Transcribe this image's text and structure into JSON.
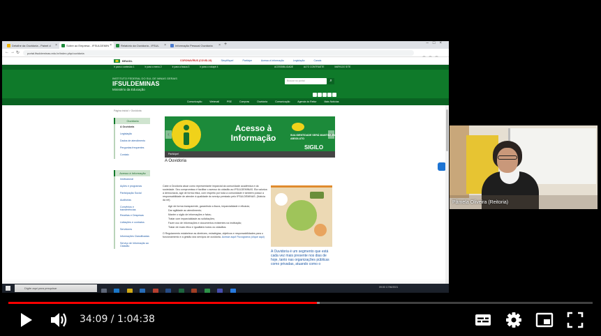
{
  "browser": {
    "tabs": [
      {
        "label": "Detalhe da Ouvidoria - Painel d",
        "active": false,
        "color": "#f0b400"
      },
      {
        "label": "Sobre ao Empresa - IFSULDEMIN",
        "active": true,
        "color": "#1d8a3b"
      },
      {
        "label": "Relatório da Ouvidoria - IFSUL",
        "active": false,
        "color": "#1d8a3b"
      },
      {
        "label": "Informação Pessoal Ouvidoria",
        "active": false,
        "color": "#4a7bd0"
      }
    ],
    "url": "portal.ifsuldeminas.edu.br/index.php/ouvidoria"
  },
  "gov_bar": {
    "brand": "BRASIL",
    "links": [
      "CORONAVÍRUS (COVID-19)",
      "Simplifique!",
      "Participe",
      "Acesso à Informação",
      "Legislação",
      "Canais"
    ]
  },
  "header": {
    "accessibility_links": [
      "Ir para o conteúdo 1",
      "Ir para o menu 2",
      "Ir para a busca 3",
      "Ir para o rodapé 4"
    ],
    "accessibility_right": [
      "ACESSIBILIDADE",
      "ALTO CONTRASTE",
      "MAPA DO SITE"
    ],
    "institution_small": "INSTITUTO FEDERAL DO SUL DE MINAS GERAIS",
    "institution_name": "IFSULDEMINAS",
    "ministry": "Ministério da Educação",
    "search_placeholder": "Buscar no portal",
    "menu": [
      "Comunicação",
      "Webmail",
      "PSE",
      "Compras",
      "Ouvidoria",
      "Comunicação",
      "Agenda do Reitor",
      "Mais Notícias"
    ]
  },
  "page": {
    "breadcrumb": "Página inicial > Ouvidoria",
    "sidebar_heading_1": "Ouvidoria",
    "sidebar_items_1": [
      "A Ouvidoria",
      "Legislação",
      "Dados de atendimento",
      "Perguntas frequentes",
      "Contato"
    ],
    "sidebar_heading_2": "Acesso à Informação",
    "sidebar_items_2": [
      "Institucional",
      "Ações e programas",
      "Participação Social",
      "Auditorias",
      "Convênios e transferências",
      "Receitas e Despesas",
      "Licitações e contratos",
      "Servidores",
      "Informações Classificadas",
      "Serviço de Informação ao Cidadão"
    ],
    "banner_title": "Acesso à Informação",
    "banner_tag": "SUA IDENTIDADE SERÁ MANTIDA EM ABSOLUTO",
    "banner_sigilo": "SIGILO",
    "banner_caption": "Participe!",
    "heading": "A Ouvidoria",
    "paragraph_1": "Cabe à Ouvidoria atuar como representante imparcial da comunidade acadêmica e da sociedade. Seu compromisso é facilitar o acesso do cidadão ao IFSULDEMINAS. Ela valoriza a democracia, age de forma ética, com respeito por toda a comunidade e também possui a responsabilidade de atender à qualidade do serviço prestado pelo IFSULDEMINAS. (Notícia da ref).",
    "bullets": [
      "Agir de forma transparente, garantindo a lisura, imparcialidade e eficácia;",
      "Dar agilidade ao atendimento;",
      "Manter o sigilo de informações e fatos;",
      "Tratar com imparcialidade as solicitações;",
      "Fazer uso de informações e documentos existentes na instituição;",
      "Tratar de modo ético e igualitário todos os cidadãos."
    ],
    "paragraph_2": "O Regulamento estabelece as diretrizes, estratégias, objetivos e responsabilidades para o funcionamento e a gestão dos serviços de ouvidoria.",
    "paragraph_2_link": "Acesse aqui! Fluxograma (clique aqui)",
    "side_text": "A Ouvidoria é um segmento que está cada vez mais presente nos dias de hoje, tanto nas organizações públicas como privadas, atuando como o"
  },
  "taskbar": {
    "search_placeholder": "Digite aqui para pesquisar",
    "tray_time": "09:00",
    "tray_date": "17/06/2021"
  },
  "webcam": {
    "name": "Pâmela Oliveira (Reitoria)"
  },
  "player": {
    "current_time": "34:09",
    "separator": " / ",
    "duration": "1:04:38",
    "progress_played": 0.528,
    "progress_buffered": 0.533,
    "played_color": "#ff0000"
  },
  "icons": {
    "play": "play-icon",
    "volume": "volume-icon",
    "subtitles": "subtitles-icon",
    "settings": "gear-icon",
    "miniplayer": "miniplayer-icon",
    "fullscreen": "fullscreen-icon"
  }
}
